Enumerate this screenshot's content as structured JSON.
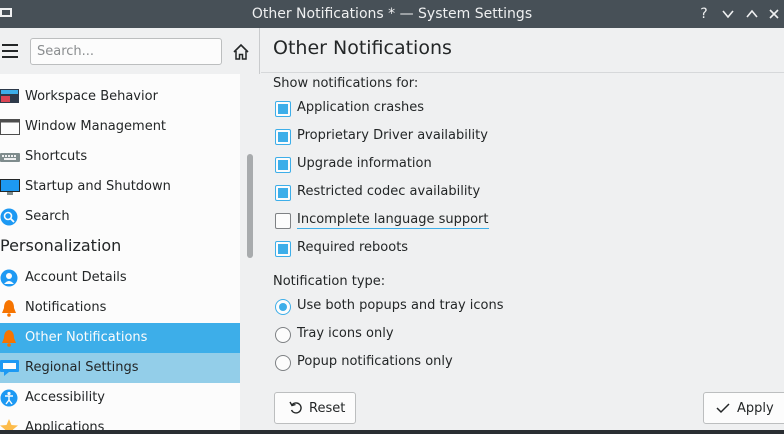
{
  "window": {
    "title": "Other Notifications * — System Settings",
    "controls": [
      "?",
      "⌄",
      "⌃",
      "✕"
    ]
  },
  "sidebar": {
    "search_placeholder": "Search...",
    "items": [
      {
        "label": "Workspace Behavior",
        "icon": "workspace-behavior-icon"
      },
      {
        "label": "Window Management",
        "icon": "window-management-icon"
      },
      {
        "label": "Shortcuts",
        "icon": "keyboard-icon"
      },
      {
        "label": "Startup and Shutdown",
        "icon": "monitor-icon"
      },
      {
        "label": "Search",
        "icon": "search-icon"
      }
    ],
    "section": "Personalization",
    "items2": [
      {
        "label": "Account Details",
        "icon": "user-icon"
      },
      {
        "label": "Notifications",
        "icon": "bell-icon"
      },
      {
        "label": "Other Notifications",
        "icon": "bell-icon",
        "state": "selected"
      },
      {
        "label": "Regional Settings",
        "icon": "speech-bubble-icon",
        "state": "hover"
      },
      {
        "label": "Accessibility",
        "icon": "accessibility-icon"
      },
      {
        "label": "Applications",
        "icon": "star-icon"
      }
    ]
  },
  "main": {
    "title": "Other Notifications",
    "show_label": "Show notifications for:",
    "checks": [
      {
        "label": "Application crashes",
        "checked": true
      },
      {
        "label": "Proprietary Driver availability",
        "checked": true
      },
      {
        "label": "Upgrade information",
        "checked": true
      },
      {
        "label": "Restricted codec availability",
        "checked": true
      },
      {
        "label": "Incomplete language support",
        "checked": false
      },
      {
        "label": "Required reboots",
        "checked": true
      }
    ],
    "type_label": "Notification type:",
    "radios": [
      {
        "label": "Use both popups and tray icons",
        "selected": true
      },
      {
        "label": "Tray icons only",
        "selected": false
      },
      {
        "label": "Popup notifications only",
        "selected": false
      }
    ],
    "reset_label": "Reset",
    "apply_label": "Apply"
  },
  "colors": {
    "accent": "#3daee9",
    "titlebar": "#475057",
    "hover": "#93cee9"
  }
}
